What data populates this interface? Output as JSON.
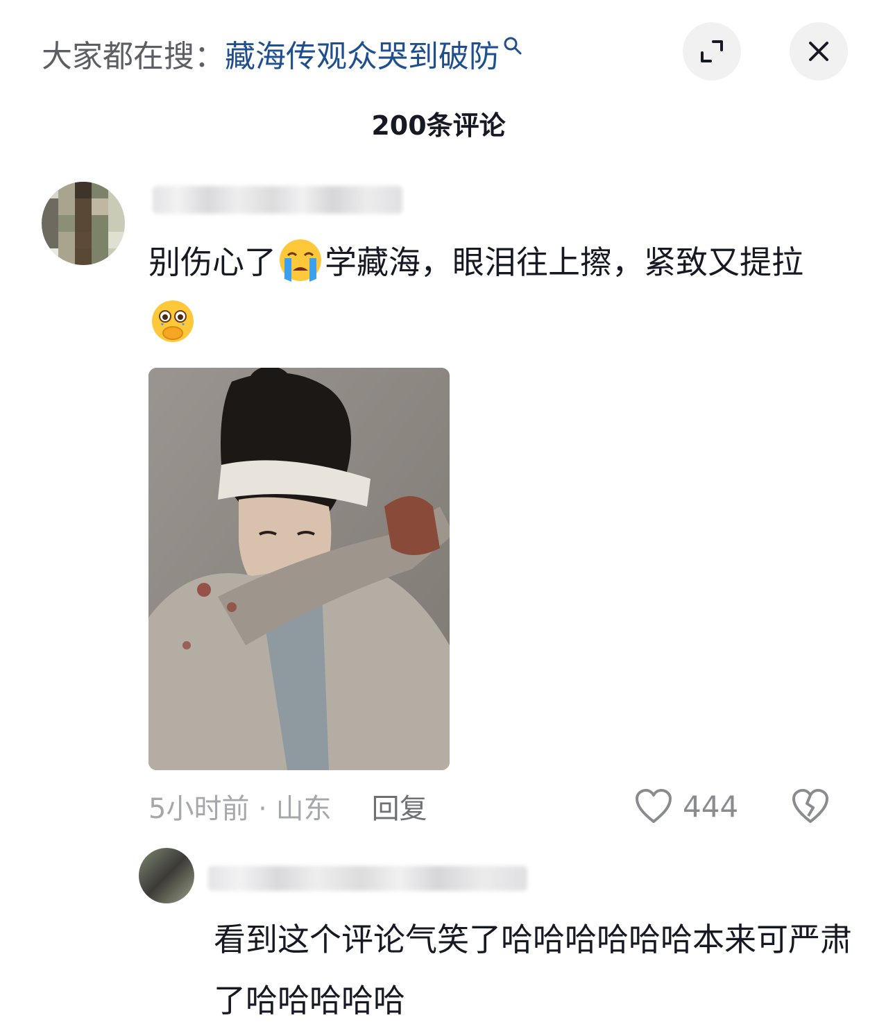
{
  "header": {
    "search_prefix": "大家都在搜：",
    "search_query": "藏海传观众哭到破防",
    "expand_icon": "expand-icon",
    "close_icon": "close-icon"
  },
  "comments_title": "200条评论",
  "comment": {
    "text_part1": "别伤心了",
    "emoji1": "loudly-crying-face-emoji",
    "text_part2": "学藏海，眼泪往上擦，紧致又提拉",
    "emoji2": "face-holding-back-tears-emoji",
    "image": "photo of a man with headband wiping tears on his sleeve",
    "time_location": "5小时前 · 山东",
    "reply_label": "回复",
    "like_count": "444",
    "like_icon": "heart-icon",
    "dislike_icon": "broken-heart-icon"
  },
  "reply": {
    "text": "看到这个评论气笑了哈哈哈哈哈哈本来可严肃了哈哈哈哈哈"
  },
  "colors": {
    "search_query": "#1f4f8f",
    "muted_text": "#a6a7ab",
    "primary_text": "#161823"
  }
}
